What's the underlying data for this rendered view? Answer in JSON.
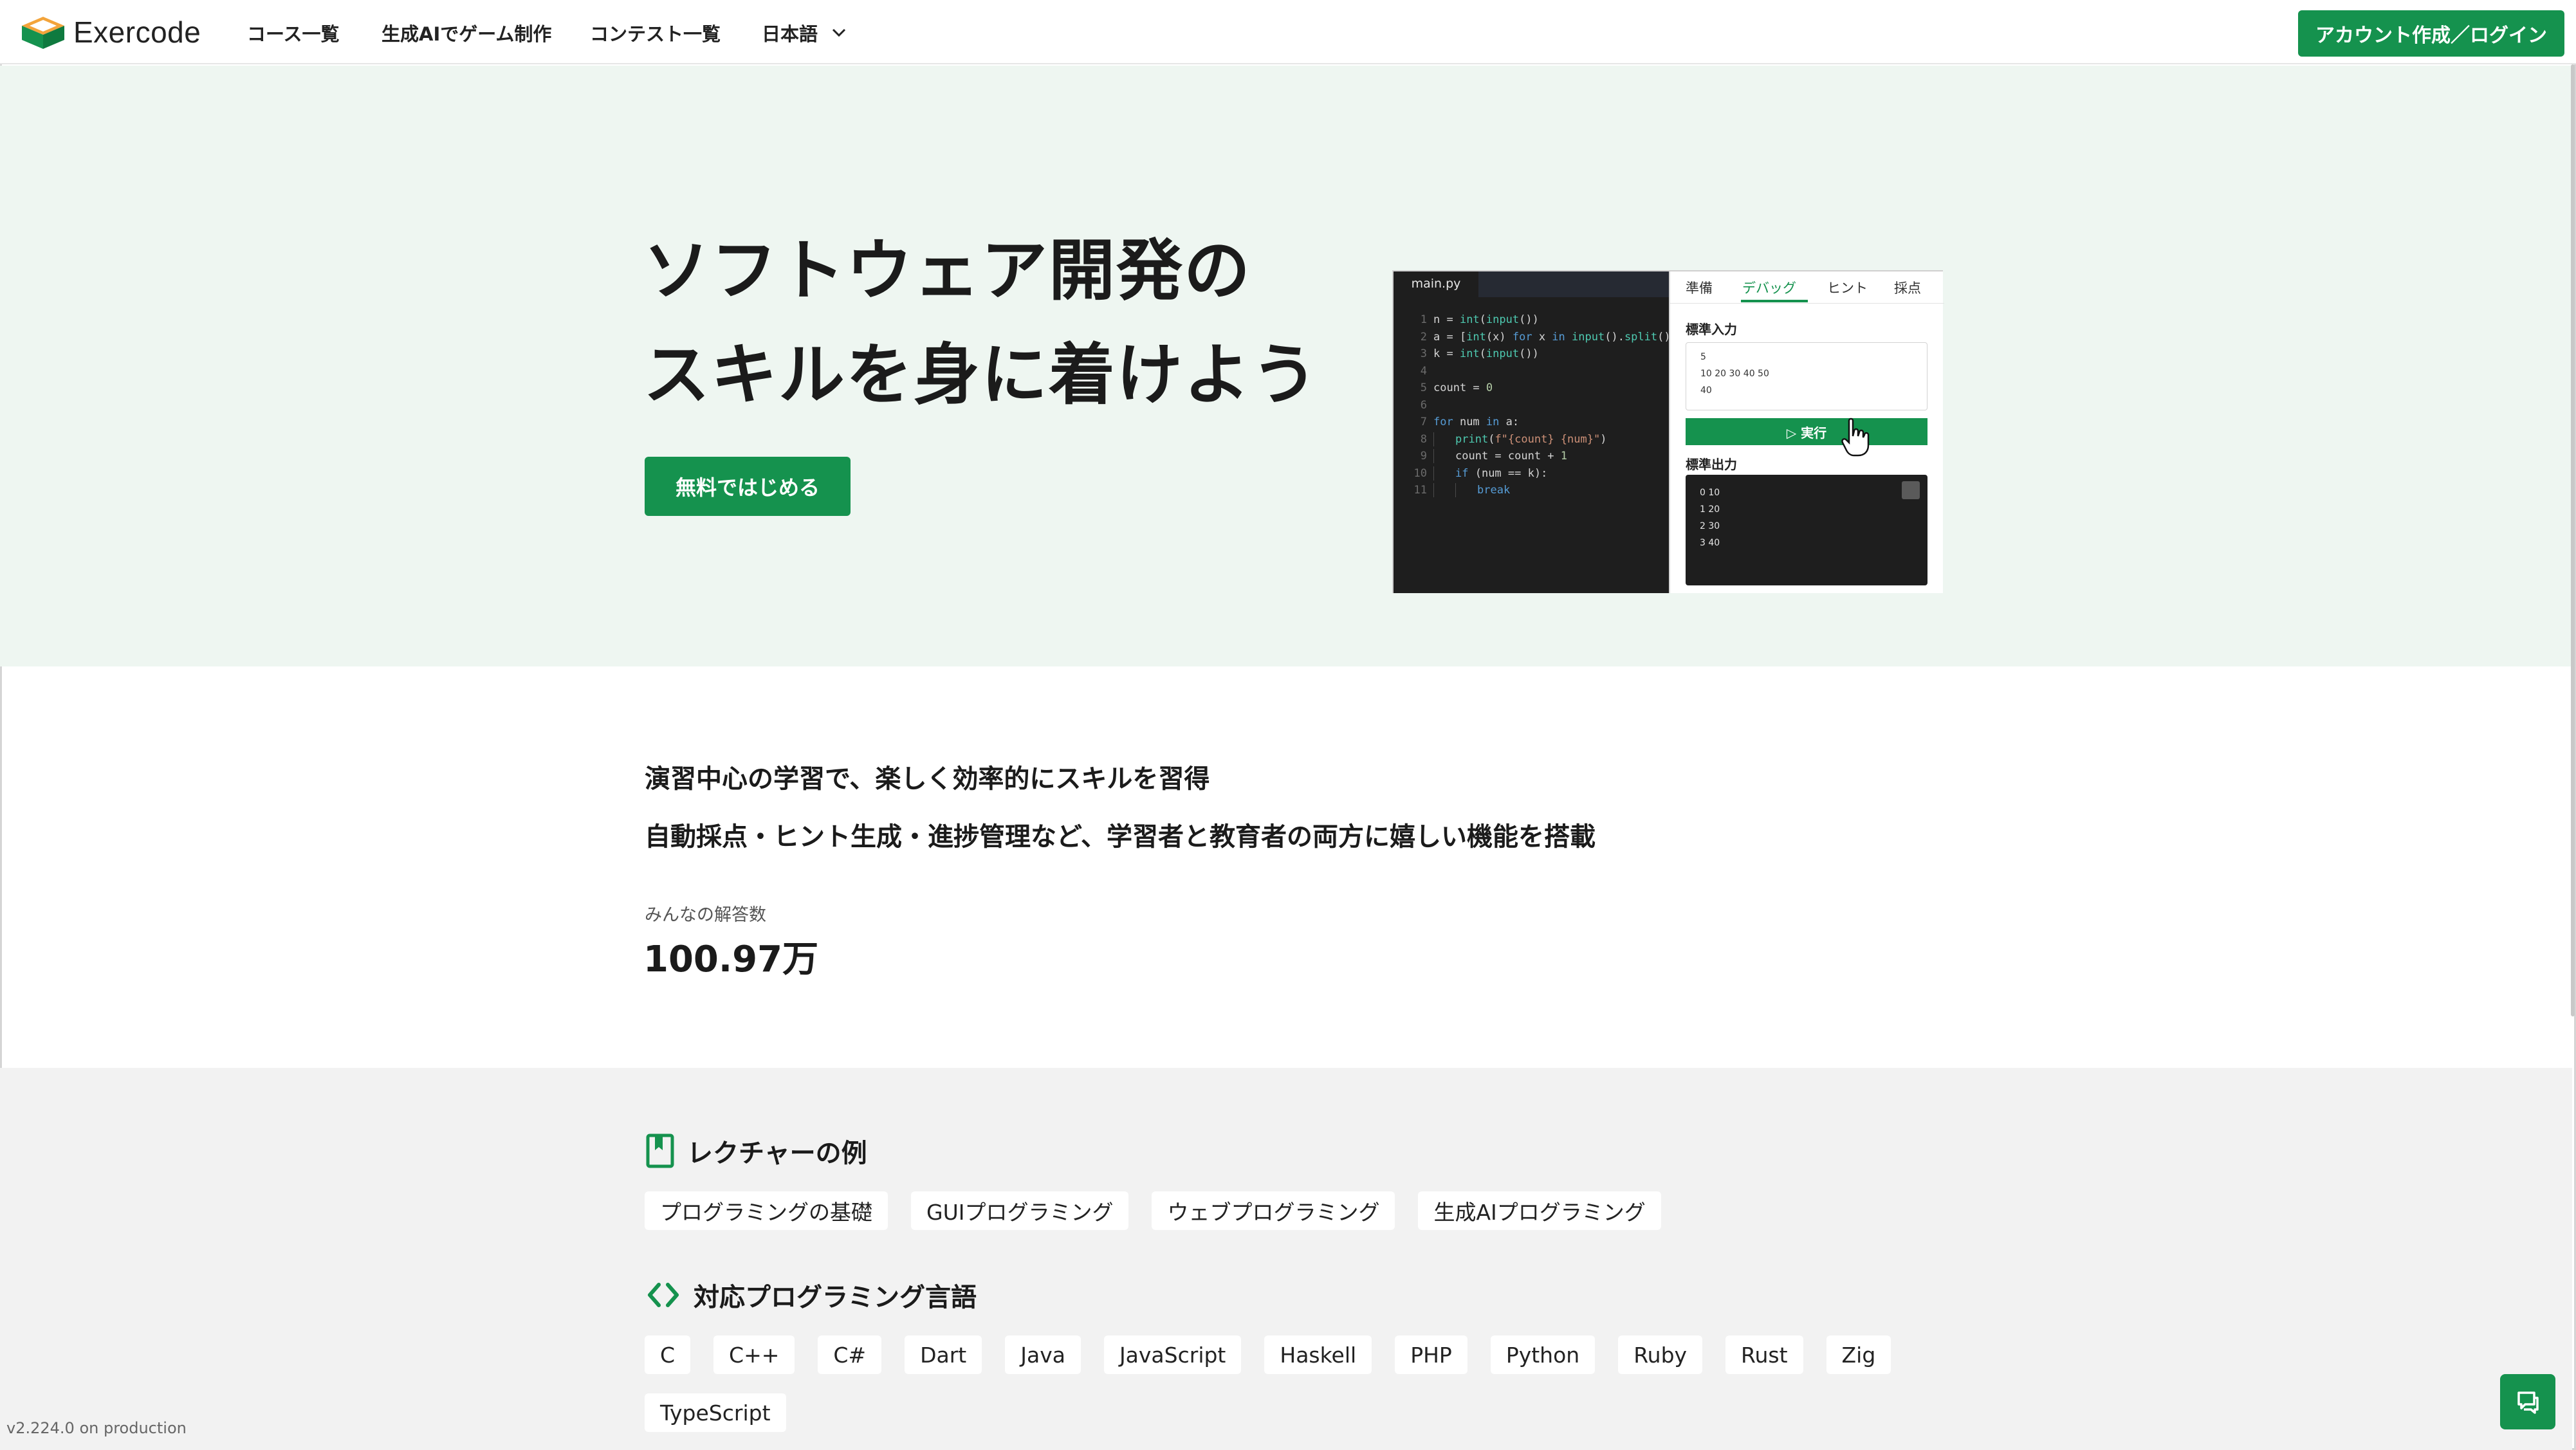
{
  "header": {
    "brand": "Exercode",
    "nav": [
      "コース一覧",
      "生成AIでゲーム制作",
      "コンテスト一覧"
    ],
    "language": "日本語",
    "login_label": "アカウント作成／ログイン"
  },
  "hero": {
    "title_line1": "ソフトウェア開発の",
    "title_line2": "スキルを身に着けよう",
    "cta_label": "無料ではじめる"
  },
  "demo": {
    "editor_tab": "main.py",
    "side_tabs": [
      "準備",
      "デバッグ",
      "ヒント",
      "採点"
    ],
    "stdin_label": "標準入力",
    "stdin_lines": [
      "5",
      "10 20 30 40 50",
      "40"
    ],
    "run_label": "▷ 実行",
    "stdout_label": "標準出力",
    "stdout_lines": [
      "0 10",
      "1 20",
      "2 30",
      "3 40"
    ]
  },
  "info": {
    "line1": "演習中心の学習で、楽しく効率的にスキルを習得",
    "line2": "自動採点・ヒント生成・進捗管理など、学習者と教育者の両方に嬉しい機能を搭載",
    "stats_label": "みんなの解答数",
    "stats_value": "100.97万"
  },
  "lectures": {
    "heading": "レクチャーの例",
    "items": [
      "プログラミングの基礎",
      "GUIプログラミング",
      "ウェブプログラミング",
      "生成AIプログラミング"
    ]
  },
  "languages": {
    "heading": "対応プログラミング言語",
    "row1": [
      "C",
      "C++",
      "C#",
      "Dart",
      "Java",
      "JavaScript",
      "Haskell",
      "PHP",
      "Python",
      "Ruby",
      "Rust",
      "Zig"
    ],
    "row2": [
      "TypeScript"
    ]
  },
  "footer": {
    "version": "v2.224.0 on production"
  },
  "colors": {
    "accent": "#15924e",
    "hero_bg": "#eef6f1",
    "section_bg": "#f2f2f2"
  }
}
